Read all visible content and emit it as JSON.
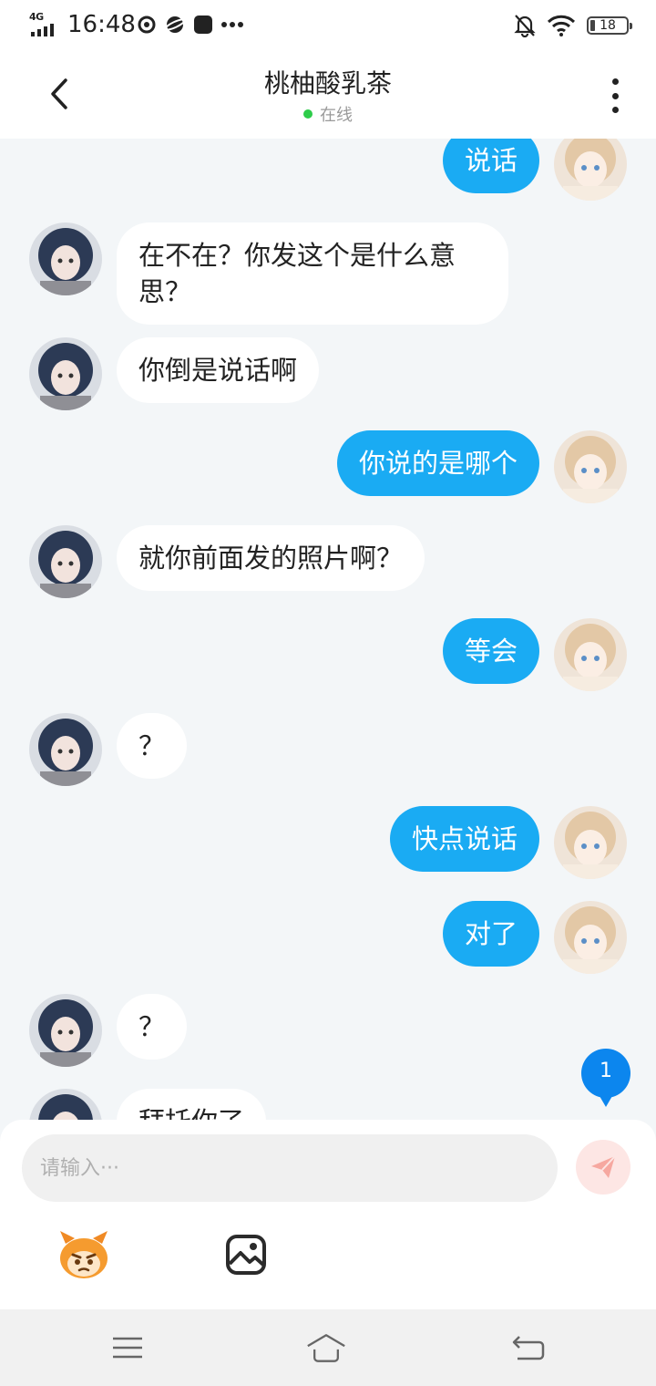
{
  "status_bar": {
    "network": "4G",
    "time": "16:48",
    "battery": "18"
  },
  "header": {
    "title": "桃柚酸乳茶",
    "status": "在线"
  },
  "messages": [
    {
      "side": "right",
      "text": "说话"
    },
    {
      "side": "left",
      "text": "在不在？你发这个是什么意思？"
    },
    {
      "side": "left",
      "text": "你倒是说话啊"
    },
    {
      "side": "right",
      "text": "你说的是哪个"
    },
    {
      "side": "left",
      "text": "就你前面发的照片啊？"
    },
    {
      "side": "right",
      "text": "等会"
    },
    {
      "side": "left",
      "text": "？"
    },
    {
      "side": "right",
      "text": "快点说话"
    },
    {
      "side": "right",
      "text": "对了"
    },
    {
      "side": "left",
      "text": "？"
    },
    {
      "side": "left",
      "text": "拜托你了"
    }
  ],
  "unread_badge": "1",
  "input": {
    "placeholder": "请输入···"
  },
  "icons": {
    "back": "chevron-left-icon",
    "more": "more-vertical-icon",
    "send": "paper-plane-icon",
    "emoji": "mascot-emoji-icon",
    "image": "image-icon",
    "nav_menu": "menu-icon",
    "nav_home": "home-icon",
    "nav_back": "back-arrow-icon"
  },
  "colors": {
    "accent": "#1aabf3",
    "online": "#2ecc4a",
    "badge": "#0c86ee",
    "send_disabled": "#fde6e4"
  }
}
